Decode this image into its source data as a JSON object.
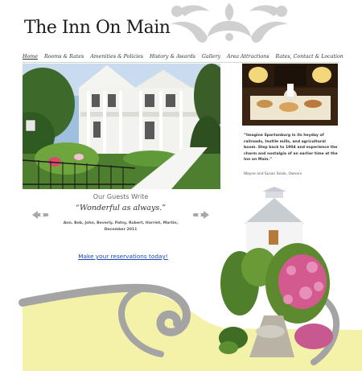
{
  "header": {
    "logo_text": "The Inn On Main",
    "logo_alt": "The Inn On Main logo"
  },
  "nav": {
    "items": [
      {
        "label": "Home",
        "active": true
      },
      {
        "label": "Rooms & Rates",
        "active": false
      },
      {
        "label": "Amenities & Policies",
        "active": false
      },
      {
        "label": "History & Awards",
        "active": false
      },
      {
        "label": "Gallery",
        "active": false
      },
      {
        "label": "Area Attractions",
        "active": false
      },
      {
        "label": "Rates, Contact & Location",
        "active": false
      }
    ],
    "separator_icon": "leaf-ornament-icon"
  },
  "intro": {
    "quote": "“Imagine Spartanburg in its heyday of railroads, textile mills, and agricultural boom. Step back to 1904 and experience the charm and nostalgia of an earlier time at the Inn on Main.”",
    "owners": "Wayne and Susan Seale, Owners"
  },
  "guests": {
    "heading": "Our Guests Write",
    "quote": "“Wonderful as always.”",
    "names": "Ann, Bob, John, Beverly, Patsy, Robert, Harriet, Martin, December 2011"
  },
  "reservation": {
    "link_text": "Make your reservations today!"
  },
  "colors": {
    "accent_link": "#1a45b8",
    "ornament_gray": "#9a9a9a",
    "cream": "#f4f1a8",
    "nav_leaf": "#b7d3c6"
  }
}
